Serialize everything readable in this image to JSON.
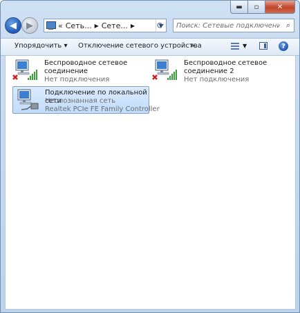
{
  "window": {
    "caption": {
      "minimize": "▬",
      "maximize": "▫",
      "close": "✕"
    }
  },
  "address_bar": {
    "prefix": "«",
    "segments": [
      "Сеть...",
      "Сете..."
    ],
    "back_glyph": "◀",
    "forward_glyph": "▶"
  },
  "search": {
    "placeholder": "Поиск: Сетевые подключения"
  },
  "toolbar": {
    "organize": "Упорядочить ▾",
    "disable_device": "Отключение сетевого устройства",
    "more": "»",
    "help": "?"
  },
  "connections": [
    {
      "name_line1": "Беспроводное сетевое",
      "name_line2": "соединение",
      "status": "Нет подключения",
      "icon": "wireless-disconnected-icon"
    },
    {
      "name_line1": "Беспроводное сетевое",
      "name_line2": "соединение 2",
      "status": "Нет подключения",
      "icon": "wireless-disconnected-icon"
    },
    {
      "name": "Подключение по локальной сети",
      "status": "Неопознанная сеть",
      "adapter": "Realtek PCIe FE Family Controller",
      "icon": "lan-connection-icon",
      "selected": true
    }
  ],
  "colors": {
    "frame": "#bcd3ee",
    "selection": "#c1dcfc",
    "selection_border": "#7da2ce",
    "disconnected_x": "#d22020",
    "signal_bars": "#34a534"
  }
}
